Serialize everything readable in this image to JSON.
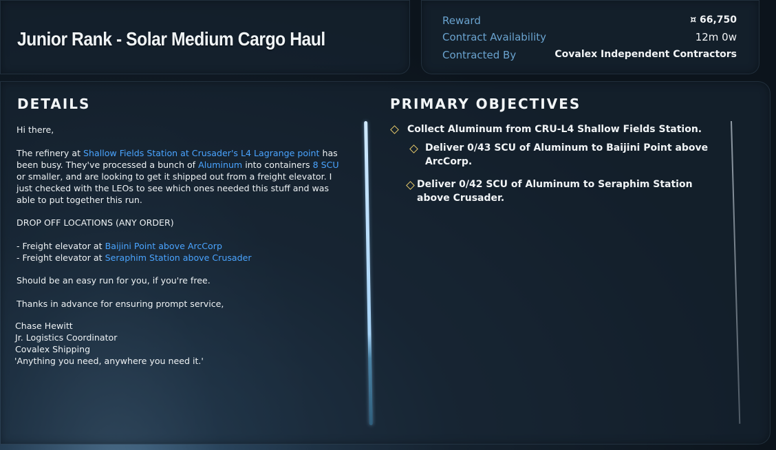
{
  "contract": {
    "title": "Junior Rank - Solar Medium Cargo Haul"
  },
  "info": {
    "reward_label": "Reward",
    "reward_value": "¤ 66,750",
    "availability_label": "Contract Availability",
    "availability_value": "12m 0w",
    "contracted_by_label": "Contracted By",
    "contracted_by_value": "Covalex Independent Contractors"
  },
  "details": {
    "heading": "DETAILS",
    "greeting": "Hi there,",
    "p1_a": "The refinery at ",
    "p1_link1": "Shallow Fields Station at Crusader's L4 Lagrange point",
    "p1_b": " has been busy. They've processed a bunch of ",
    "p1_link2": "Aluminum",
    "p1_c": " into containers ",
    "p1_link3": "8 SCU",
    "p1_d": " or smaller, and are looking to get it shipped out from a freight elevator. I just checked with the LEOs to see which ones needed this stuff and was able to put together this run.",
    "dropoff_heading": "DROP OFF LOCATIONS (ANY ORDER)",
    "drop1_prefix": "- Freight elevator at ",
    "drop1_link": "Baijini Point above ArcCorp",
    "drop2_prefix": "- Freight elevator at ",
    "drop2_link": "Seraphim Station above Crusader",
    "easy_run": "Should be an easy run for you, if you're free.",
    "thanks": "Thanks in advance for ensuring prompt service,",
    "sig_name": "Chase Hewitt",
    "sig_title": "Jr. Logistics Coordinator",
    "sig_company": "Covalex Shipping",
    "sig_motto": "'Anything you need, anywhere you need it.'"
  },
  "objectives": {
    "heading": "PRIMARY OBJECTIVES",
    "items": [
      {
        "text": "Collect Aluminum from CRU-L4 Shallow Fields Station."
      },
      {
        "text": "Deliver 0/43 SCU of Aluminum to Baijini Point above ArcCorp."
      },
      {
        "text": "Deliver 0/42 SCU of Aluminum to Seraphim Station above Crusader."
      }
    ]
  },
  "colors": {
    "link": "#4aa4ff",
    "label": "#6aa3cf",
    "objective_marker": "#e6c86a"
  }
}
